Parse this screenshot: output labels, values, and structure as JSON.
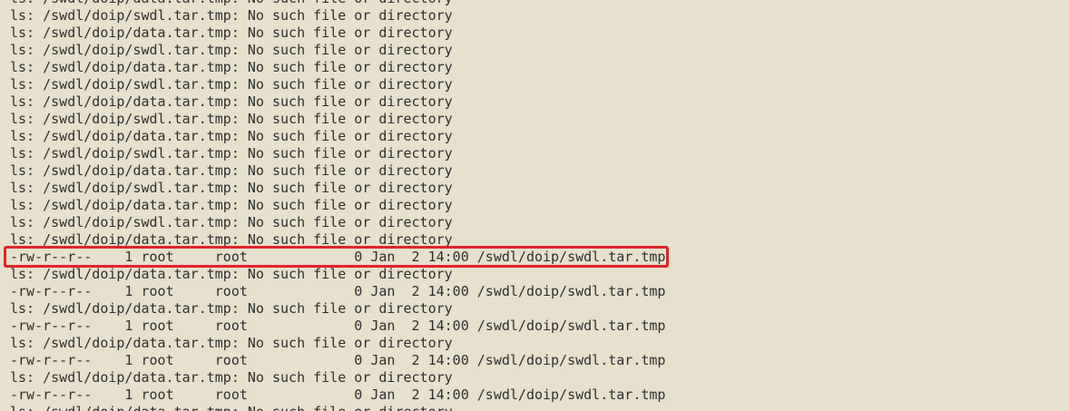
{
  "terminal": {
    "lines": [
      "ls: /swdl/doip/data.tar.tmp: No such file or directory",
      "ls: /swdl/doip/swdl.tar.tmp: No such file or directory",
      "ls: /swdl/doip/data.tar.tmp: No such file or directory",
      "ls: /swdl/doip/swdl.tar.tmp: No such file or directory",
      "ls: /swdl/doip/data.tar.tmp: No such file or directory",
      "ls: /swdl/doip/swdl.tar.tmp: No such file or directory",
      "ls: /swdl/doip/data.tar.tmp: No such file or directory",
      "ls: /swdl/doip/swdl.tar.tmp: No such file or directory",
      "ls: /swdl/doip/data.tar.tmp: No such file or directory",
      "ls: /swdl/doip/swdl.tar.tmp: No such file or directory",
      "ls: /swdl/doip/data.tar.tmp: No such file or directory",
      "ls: /swdl/doip/swdl.tar.tmp: No such file or directory",
      "ls: /swdl/doip/data.tar.tmp: No such file or directory",
      "ls: /swdl/doip/swdl.tar.tmp: No such file or directory",
      "ls: /swdl/doip/data.tar.tmp: No such file or directory",
      "-rw-r--r--    1 root     root             0 Jan  2 14:00 /swdl/doip/swdl.tar.tmp",
      "ls: /swdl/doip/data.tar.tmp: No such file or directory",
      "-rw-r--r--    1 root     root             0 Jan  2 14:00 /swdl/doip/swdl.tar.tmp",
      "ls: /swdl/doip/data.tar.tmp: No such file or directory",
      "-rw-r--r--    1 root     root             0 Jan  2 14:00 /swdl/doip/swdl.tar.tmp",
      "ls: /swdl/doip/data.tar.tmp: No such file or directory",
      "-rw-r--r--    1 root     root             0 Jan  2 14:00 /swdl/doip/swdl.tar.tmp",
      "ls: /swdl/doip/data.tar.tmp: No such file or directory",
      "-rw-r--r--    1 root     root             0 Jan  2 14:00 /swdl/doip/swdl.tar.tmp",
      "ls: /swdl/doip/data.tar.tmp: No such file or directory"
    ]
  },
  "highlight": {
    "color": "#e0242b"
  }
}
